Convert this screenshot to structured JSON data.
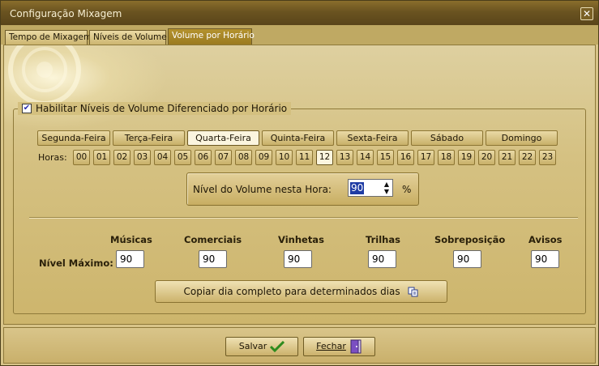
{
  "window": {
    "title": "Configuração Mixagem"
  },
  "tabs": [
    {
      "label": "Tempo de Mixagem",
      "active": false
    },
    {
      "label": "Níveis de Volume",
      "active": false
    },
    {
      "label": "Volume por Horário",
      "active": true
    }
  ],
  "enable": {
    "label": "Habilitar Níveis de Volume Diferenciado por Horário",
    "checked": true
  },
  "days": [
    {
      "label": "Segunda-Feira",
      "selected": false
    },
    {
      "label": "Terça-Feira",
      "selected": false
    },
    {
      "label": "Quarta-Feira",
      "selected": true
    },
    {
      "label": "Quinta-Feira",
      "selected": false
    },
    {
      "label": "Sexta-Feira",
      "selected": false
    },
    {
      "label": "Sábado",
      "selected": false
    },
    {
      "label": "Domingo",
      "selected": false
    }
  ],
  "hours_label": "Horas:",
  "hours": [
    "00",
    "01",
    "02",
    "03",
    "04",
    "05",
    "06",
    "07",
    "08",
    "09",
    "10",
    "11",
    "12",
    "13",
    "14",
    "15",
    "16",
    "17",
    "18",
    "19",
    "20",
    "21",
    "22",
    "23"
  ],
  "selected_hour": "12",
  "volume": {
    "label": "Nível do Volume nesta Hora:",
    "value": "90",
    "unit": "%"
  },
  "levels": {
    "row_label": "Nível Máximo:",
    "columns": [
      {
        "label": "Músicas",
        "value": "90"
      },
      {
        "label": "Comerciais",
        "value": "90"
      },
      {
        "label": "Vinhetas",
        "value": "90"
      },
      {
        "label": "Trilhas",
        "value": "90"
      },
      {
        "label": "Sobreposição",
        "value": "90"
      },
      {
        "label": "Avisos",
        "value": "90"
      }
    ]
  },
  "copy_button": {
    "label": "Copiar dia completo para determinados dias",
    "icon": "copy-icon"
  },
  "footer": {
    "save": {
      "label": "Salvar",
      "icon": "checkmark-icon"
    },
    "close": {
      "label": "Fechar",
      "icon": "exit-door-icon"
    }
  },
  "colors": {
    "titlebar": "#6a5320",
    "panel": "#d5c182",
    "selection": "#1f3ca4",
    "check": "#2e8b1e"
  }
}
